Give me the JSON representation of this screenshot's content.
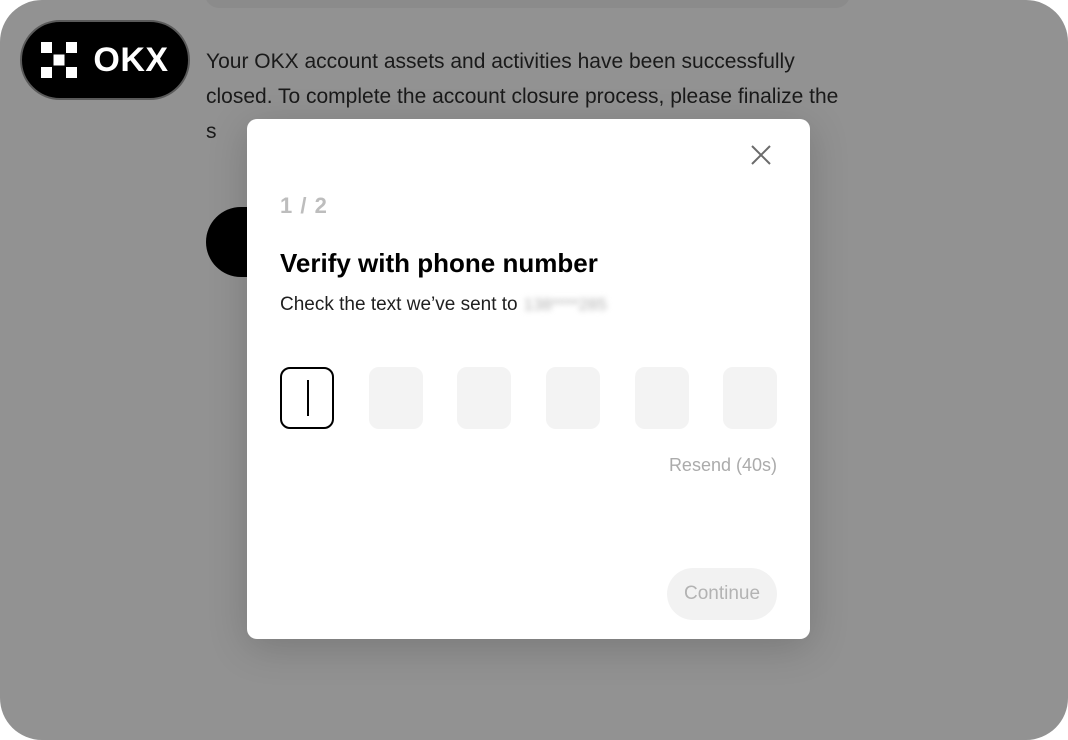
{
  "brand": {
    "name": "OKX",
    "icon": "okx-checker-logo"
  },
  "background": {
    "message": "Your OKX account assets and activities have been successfully closed. To complete the account closure process, please finalize the s"
  },
  "modal": {
    "step": "1 / 2",
    "title": "Verify with phone number",
    "subtitle": "Check the text we’ve sent to",
    "masked_phone": "138****285",
    "code_digits": [
      "",
      "",
      "",
      "",
      "",
      ""
    ],
    "resend_label": "Resend (40s)",
    "continue_label": "Continue",
    "close_icon": "close-icon"
  },
  "colors": {
    "overlay": "#929292",
    "brand_black": "#000000",
    "disabled_text": "#b3b3b3"
  }
}
